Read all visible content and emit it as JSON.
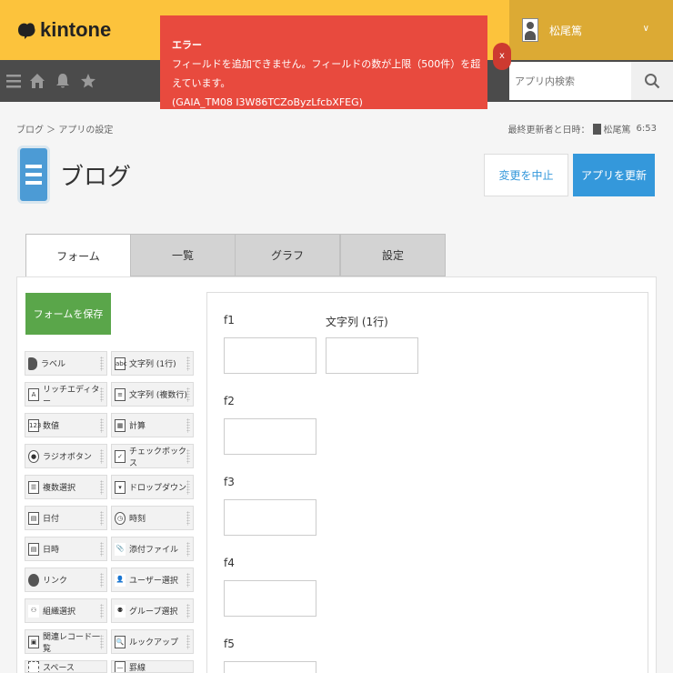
{
  "header": {
    "logo_text": "kintone",
    "user_name": "松尾篤",
    "brand_color": "#fcc33c"
  },
  "toolbar": {
    "icons": [
      "menu-icon",
      "home-icon",
      "bell-icon",
      "star-icon"
    ],
    "search_placeholder": "アプリ内検索"
  },
  "toast": {
    "title": "エラー",
    "message": "フィールドを追加できません。フィールドの数が上限（500件）を超えています。",
    "code": "(GAIA_TM08 I3W86TCZoByzLfcbXFEG)",
    "close_label": "x",
    "color": "#e84a3e"
  },
  "breadcrumb": "ブログ ＞ アプリの設定",
  "meta": {
    "label": "最終更新者と日時：",
    "user": "松尾篤",
    "time": "6:53"
  },
  "app": {
    "title": "ブログ"
  },
  "actions": {
    "cancel_label": "変更を中止",
    "update_label": "アプリを更新"
  },
  "tabs": [
    {
      "label": "フォーム",
      "active": true
    },
    {
      "label": "一覧",
      "active": false
    },
    {
      "label": "グラフ",
      "active": false
    },
    {
      "label": "設定",
      "active": false
    }
  ],
  "palette": {
    "save_label": "フォームを保存",
    "items": [
      {
        "label": "ラベル",
        "icon": "tag-icon"
      },
      {
        "label": "文字列 (1行)",
        "icon": "text-line-icon"
      },
      {
        "label": "リッチエディター",
        "icon": "rich-editor-icon"
      },
      {
        "label": "文字列 (複数行)",
        "icon": "text-multiline-icon"
      },
      {
        "label": "数値",
        "icon": "number-icon"
      },
      {
        "label": "計算",
        "icon": "calculator-icon"
      },
      {
        "label": "ラジオボタン",
        "icon": "radio-icon"
      },
      {
        "label": "チェックボックス",
        "icon": "checkbox-icon"
      },
      {
        "label": "複数選択",
        "icon": "multi-select-icon"
      },
      {
        "label": "ドロップダウン",
        "icon": "dropdown-icon"
      },
      {
        "label": "日付",
        "icon": "date-icon"
      },
      {
        "label": "時刻",
        "icon": "clock-icon"
      },
      {
        "label": "日時",
        "icon": "datetime-icon"
      },
      {
        "label": "添付ファイル",
        "icon": "attachment-icon"
      },
      {
        "label": "リンク",
        "icon": "link-icon"
      },
      {
        "label": "ユーザー選択",
        "icon": "user-icon"
      },
      {
        "label": "組織選択",
        "icon": "organization-icon"
      },
      {
        "label": "グループ選択",
        "icon": "group-icon"
      },
      {
        "label": "関連レコード一覧",
        "icon": "related-records-icon"
      },
      {
        "label": "ルックアップ",
        "icon": "lookup-icon"
      },
      {
        "label": "スペース",
        "icon": "space-icon"
      },
      {
        "label": "罫線",
        "icon": "line-icon"
      }
    ]
  },
  "form": {
    "fields": [
      {
        "label": "f1"
      },
      {
        "label": "文字列 (1行)"
      },
      {
        "label": "f2"
      },
      {
        "label": "f3"
      },
      {
        "label": "f4"
      },
      {
        "label": "f5"
      }
    ]
  }
}
